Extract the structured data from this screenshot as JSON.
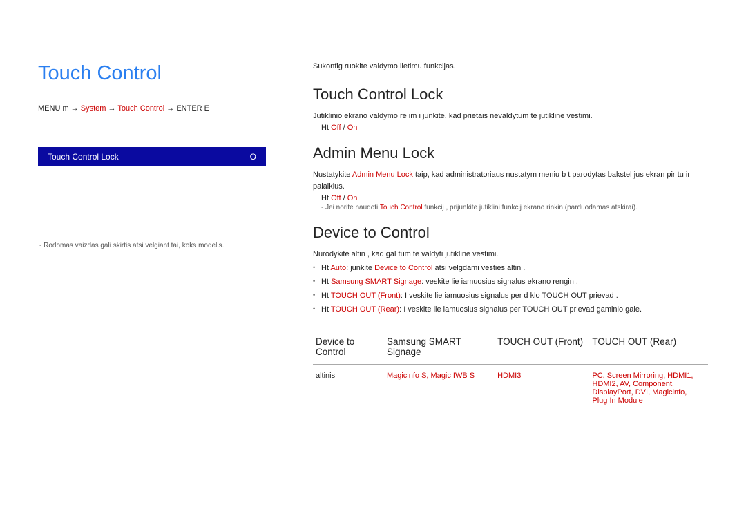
{
  "left": {
    "title": "Touch Control",
    "breadcrumb": {
      "p1": "MENU m → ",
      "p2": "System",
      "p3": " → ",
      "p4": "Touch Control",
      "p5": " → ENTER E"
    },
    "menu_item_label": "Touch Control Lock",
    "menu_item_value": "O",
    "footnote": "Rodomas vaizdas gali skirtis atsi velgiant   tai, koks modelis."
  },
  "right": {
    "intro": "Sukonfig ruokite valdymo lietimu funkcijas.",
    "sec1": {
      "heading": "Touch Control Lock",
      "desc": "Jutiklinio ekrano valdymo re im  i junkite, kad prietais  nevaldytum te jutikline  vestimi.",
      "opt_prefix": "Ht   ",
      "opt_off": "Off",
      "opt_sep": " / ",
      "opt_on": "On"
    },
    "sec2": {
      "heading": "Admin Menu Lock",
      "desc_p1": "Nustatykite ",
      "desc_hl": "Admin Menu Lock",
      "desc_p2": " taip, kad administratoriaus nustatym  meniu b t  parodytas bakstel jus ekran  pir tu ir palaikius.",
      "opt_prefix": "Ht   ",
      "opt_off": "Off",
      "opt_sep": " / ",
      "opt_on": "On",
      "note_p1": "Jei norite naudoti ",
      "note_hl": "Touch Control",
      "note_p2": " funkcij , prijunkite jutiklini  funkcij  ekrano rinkin  (parduodamas atskirai)."
    },
    "sec3": {
      "heading": "Device to Control",
      "desc": "Nurodykite  altin , kad gal tum te valdyti jutikline  vestimi.",
      "lines": [
        {
          "prefix": "Ht   ",
          "hl": "Auto",
          "mid": ":  junkite ",
          "hl2": "Device to Control",
          "rest": " atsi velgdami    vesties  altin ."
        },
        {
          "prefix": "Ht   ",
          "hl": "Samsung SMART Signage",
          "rest": ": veskite lie iamuosius signalus   ekrano  rengin ."
        },
        {
          "prefix": "Ht   ",
          "hl": "TOUCH OUT (Front)",
          "rest": ": I veskite lie iamuosius signalus per d klo TOUCH OUT prievad ."
        },
        {
          "prefix": "Ht   ",
          "hl": "TOUCH OUT (Rear)",
          "rest": ": I veskite lie iamuosius signalus per TOUCH OUT prievad  gaminio gale."
        }
      ]
    },
    "table": {
      "h1": "Device to Control",
      "h2": "Samsung SMART Signage",
      "h3": "TOUCH OUT (Front)",
      "h4": "TOUCH OUT (Rear)",
      "r1c1": " altinis",
      "r1c2": "Magicinfo S, Magic IWB S",
      "r1c3": "HDMI3",
      "r1c4": "PC, Screen Mirroring, HDMI1, HDMI2, AV, Component, DisplayPort, DVI, Magicinfo, Plug In Module"
    }
  }
}
